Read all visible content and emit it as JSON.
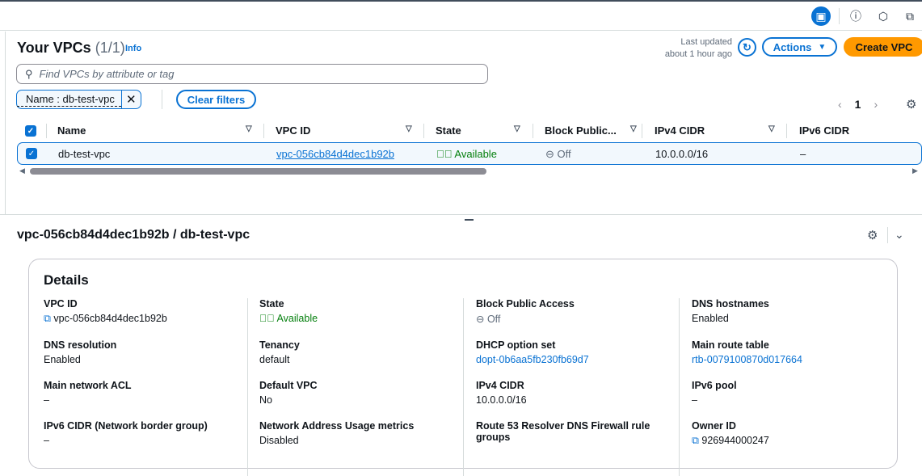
{
  "topbar": {
    "icons": [
      "panel-icon",
      "info-icon",
      "notifications-icon",
      "feedback-icon"
    ]
  },
  "header": {
    "title": "Your VPCs",
    "count": "(1/1)",
    "info": "Info",
    "last_updated_label": "Last updated",
    "last_updated_value": "about 1 hour ago",
    "actions": "Actions",
    "actions_caret": "▼",
    "create": "Create VPC"
  },
  "search": {
    "placeholder": "Find VPCs by attribute or tag"
  },
  "filter": {
    "token": "Name : db-test-vpc",
    "clear": "Clear filters"
  },
  "pagination": {
    "prev": "‹",
    "page": "1",
    "next": "›"
  },
  "table": {
    "columns": [
      "Name",
      "VPC ID",
      "State",
      "Block Public...",
      "IPv4 CIDR",
      "IPv6 CIDR"
    ],
    "rows": [
      {
        "name": "db-test-vpc",
        "vpc_id": "vpc-056cb84d4dec1b92b",
        "state": "Available",
        "block_public": "Off",
        "ipv4": "10.0.0.0/16",
        "ipv6": "–"
      }
    ]
  },
  "details": {
    "title": "vpc-056cb84d4dec1b92b / db-test-vpc",
    "heading": "Details",
    "fields": [
      {
        "k": "VPC ID",
        "v": "vpc-056cb84d4dec1b92b"
      },
      {
        "k": "State",
        "v": "Available"
      },
      {
        "k": "Block Public Access",
        "v": "Off"
      },
      {
        "k": "DNS hostnames",
        "v": "Enabled"
      },
      {
        "k": "DNS resolution",
        "v": "Enabled"
      },
      {
        "k": "Tenancy",
        "v": "default"
      },
      {
        "k": "DHCP option set",
        "v": "dopt-0b6aa5fb230fb69d7"
      },
      {
        "k": "Main route table",
        "v": "rtb-0079100870d017664"
      },
      {
        "k": "Main network ACL",
        "v": "–"
      },
      {
        "k": "Default VPC",
        "v": "No"
      },
      {
        "k": "IPv4 CIDR",
        "v": "10.0.0.0/16"
      },
      {
        "k": "IPv6 pool",
        "v": "–"
      },
      {
        "k": "IPv6 CIDR (Network border group)",
        "v": "–"
      },
      {
        "k": "Network Address Usage metrics",
        "v": "Disabled"
      },
      {
        "k": "Route 53 Resolver DNS Firewall rule groups",
        "v": ""
      },
      {
        "k": "Owner ID",
        "v": "926944000247"
      }
    ]
  },
  "colors": {
    "accent": "#0972d3",
    "primary": "#ff9900",
    "success": "#037f0c"
  }
}
